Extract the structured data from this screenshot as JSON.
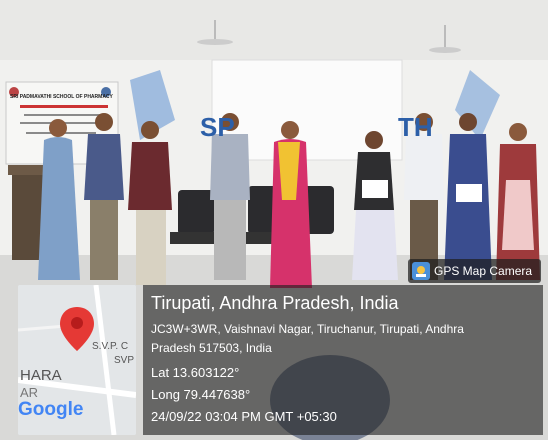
{
  "scene": {
    "banner_institution": "SRI PADMAVATHI SCHOOL OF PHARMACY",
    "banner_event_letters": "SP",
    "banner_event_letters_2": "TH"
  },
  "overlay": {
    "badge_label": "GPS Map Camera",
    "location_title": "Tirupati, Andhra Pradesh, India",
    "address_line1": "JC3W+3WR, Vaishnavi Nagar, Tiruchanur, Tirupati, Andhra",
    "address_line2": "Pradesh 517503, India",
    "latitude": "Lat 13.603122°",
    "longitude": "Long 79.447638°",
    "datetime": "24/09/22 03:04 PM GMT +05:30"
  },
  "map": {
    "label_svp": "S.V.P. C",
    "label_svp2": "SVP",
    "label_hara": "HARA",
    "label_ar": "AR",
    "logo_text": "Google",
    "pin_color": "#e53935"
  }
}
